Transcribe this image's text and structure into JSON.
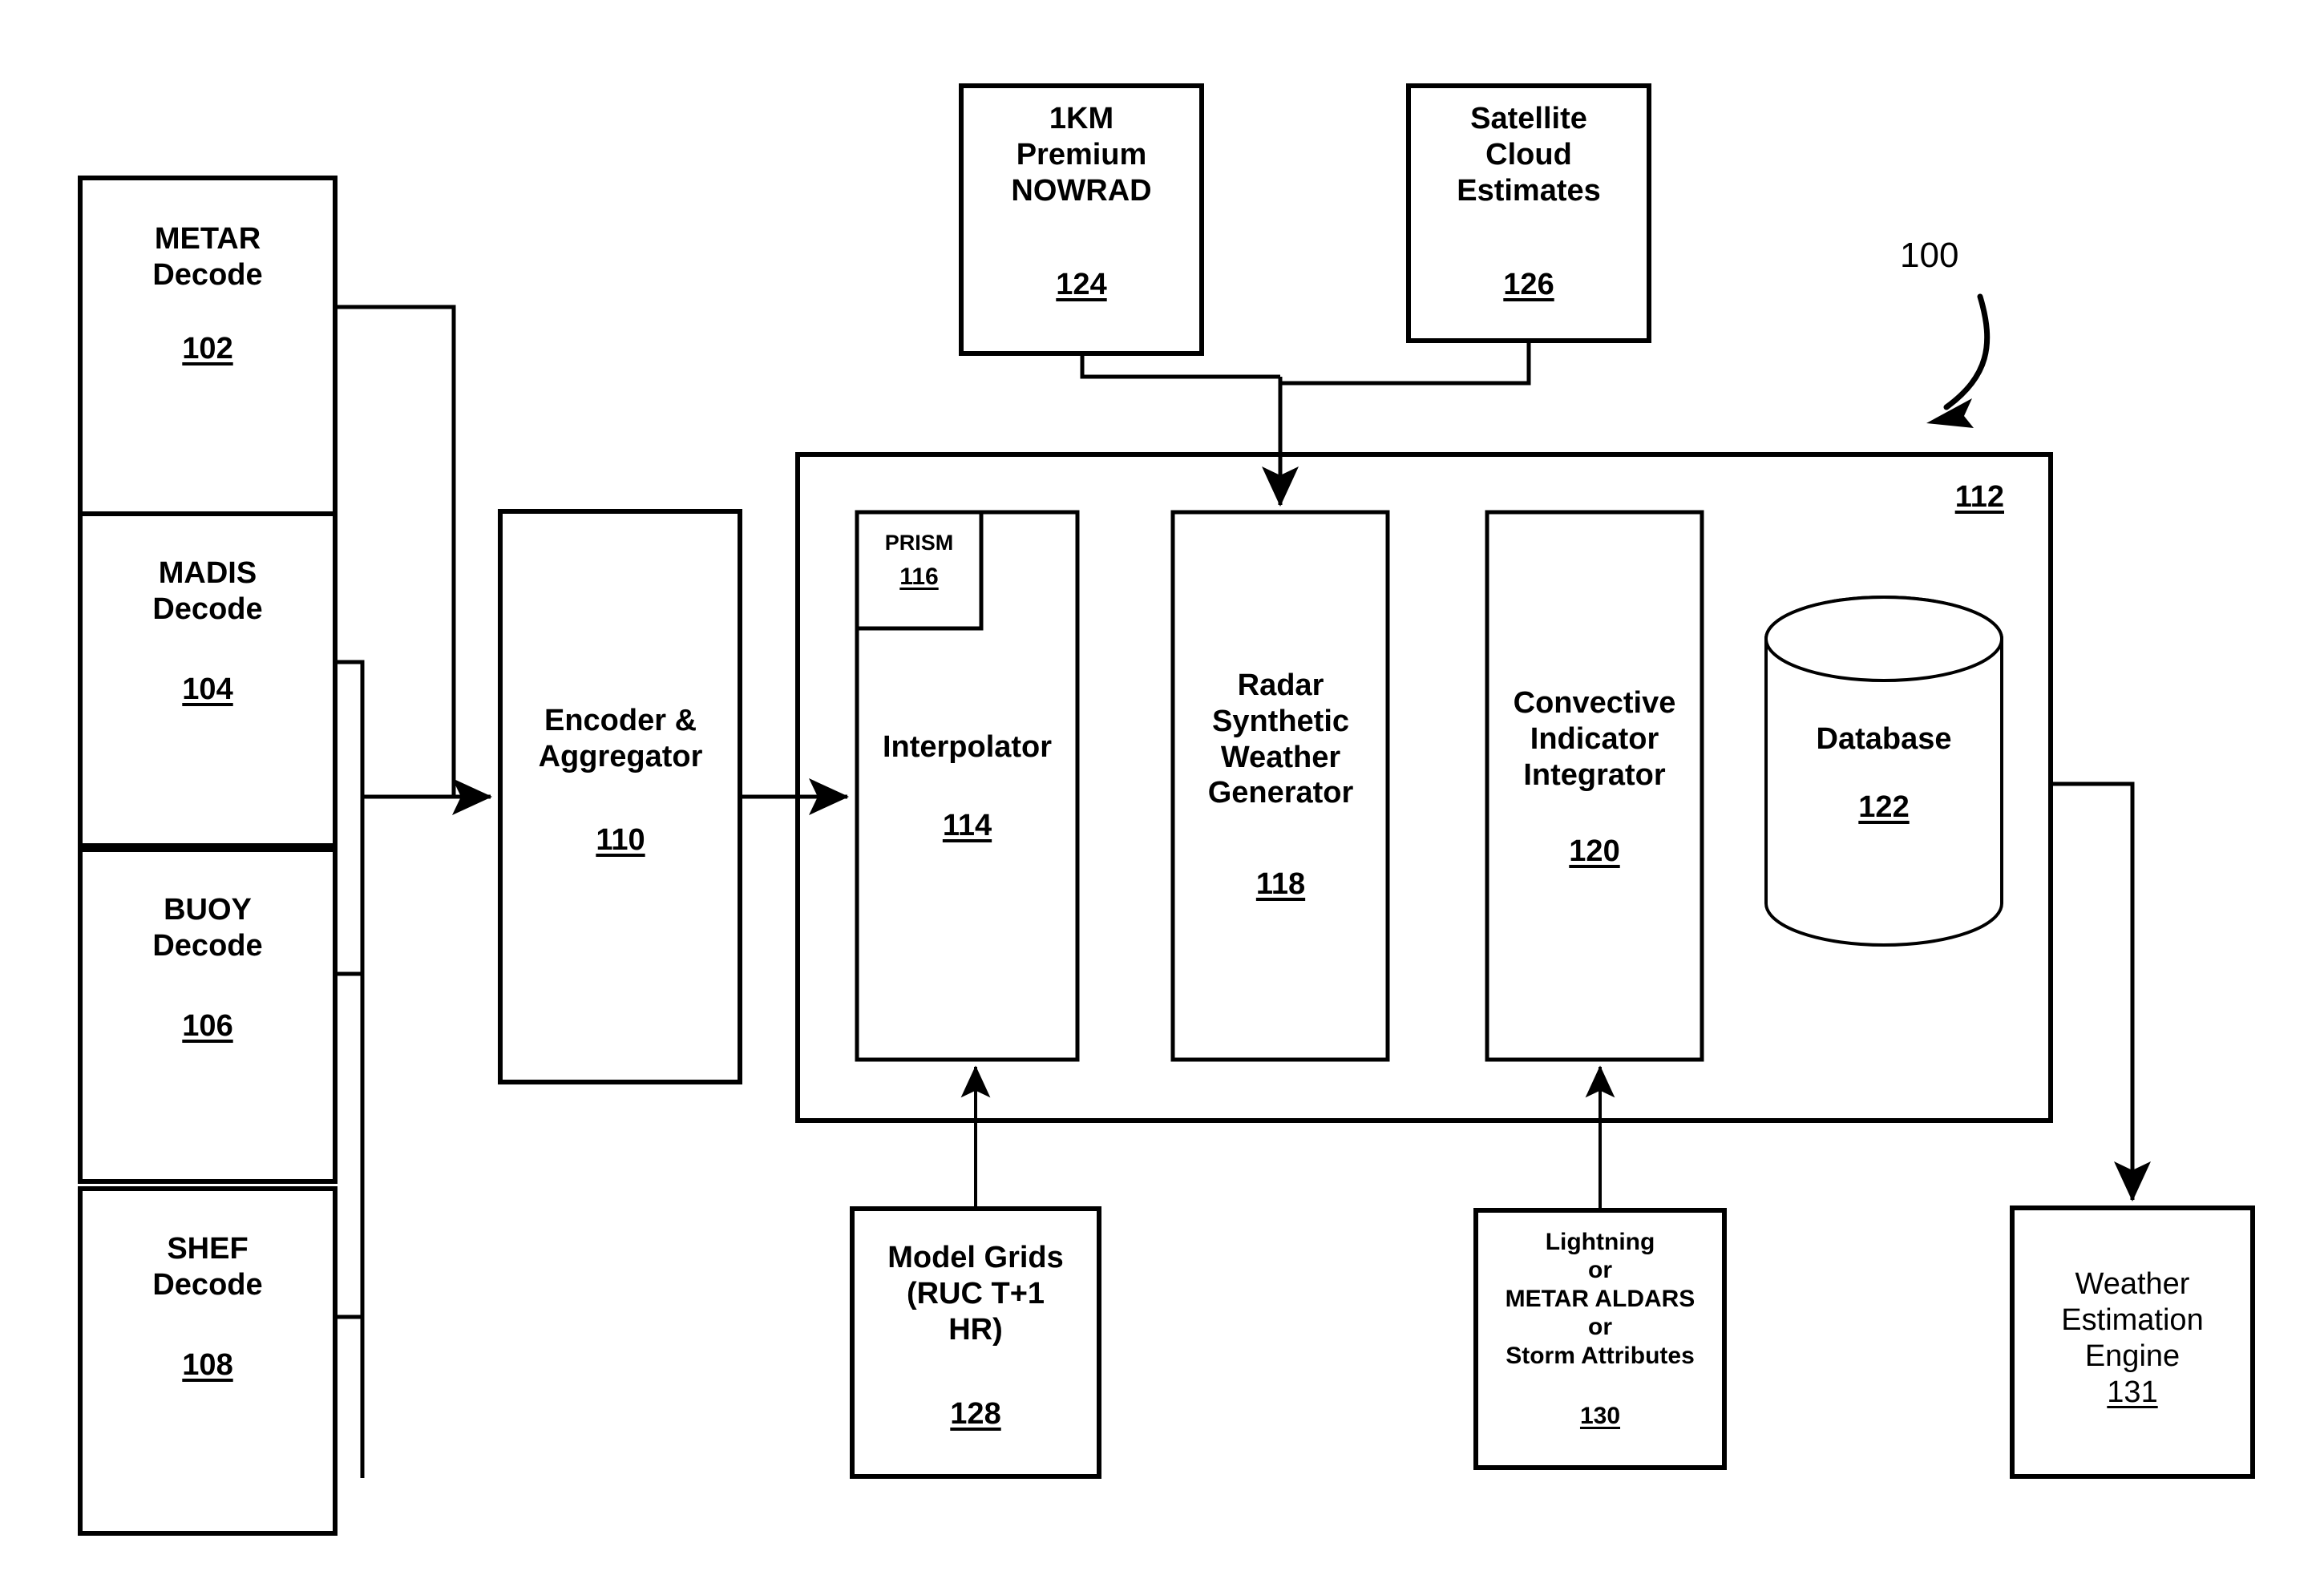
{
  "figure": {
    "reference_numeral": "100",
    "system_container": {
      "label": "112"
    },
    "boxes": {
      "metar": {
        "title": "METAR\nDecode",
        "num": "102"
      },
      "madis": {
        "title": "MADIS\nDecode",
        "num": "104"
      },
      "buoy": {
        "title": "BUOY\nDecode",
        "num": "106"
      },
      "shef": {
        "title": "SHEF\nDecode",
        "num": "108"
      },
      "encoder": {
        "title": "Encoder &\nAggregator",
        "num": "110"
      },
      "nowrad": {
        "title": "1KM\nPremium\nNOWRAD",
        "num": "124"
      },
      "satellite": {
        "title": "Satellite\nCloud\nEstimates",
        "num": "126"
      },
      "prism": {
        "title": "PRISM",
        "num": "116"
      },
      "interpolator": {
        "title": "Interpolator",
        "num": "114"
      },
      "radar_gen": {
        "title": "Radar\nSynthetic\nWeather\nGenerator",
        "num": "118"
      },
      "convective": {
        "title": "Convective\nIndicator\nIntegrator",
        "num": "120"
      },
      "database": {
        "title": "Database",
        "num": "122"
      },
      "model_grids": {
        "title": "Model Grids\n(RUC T+1\nHR)",
        "num": "128"
      },
      "lightning": {
        "title": "Lightning\nor\nMETAR ALDARS\nor\nStorm Attributes",
        "num": "130"
      },
      "weather_engine": {
        "title": "Weather\nEstimation\nEngine",
        "num": "131"
      }
    }
  },
  "colors": {
    "stroke": "#000000",
    "fill": "#ffffff"
  }
}
